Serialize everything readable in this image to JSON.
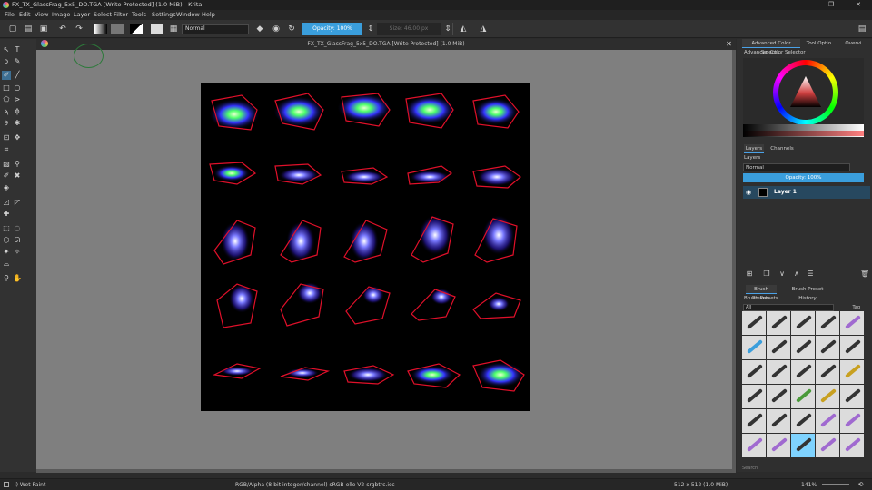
{
  "window": {
    "title": "FX_TX_GlassFrag_5x5_DO.TGA [Write Protected]  (1.0 MiB)  - Krita",
    "buttons": [
      "–",
      "❐",
      "✕"
    ]
  },
  "menu": [
    "File",
    "Edit",
    "View",
    "Image",
    "Layer",
    "Select",
    "Filter",
    "Tools",
    "Settings",
    "Window",
    "Help"
  ],
  "toolbar": {
    "blend_mode": "Normal",
    "opacity_label": "Opacity:  100%",
    "size_label": "Size:  46.00 px"
  },
  "document": {
    "tab_title": "FX_TX_GlassFrag_5x5_DO.TGA [Write Protected]  (1.0 MiB)"
  },
  "dock": {
    "top_tabs": [
      "Advanced Color Select...",
      "Tool Optio...",
      "Overvi..."
    ],
    "color_selector_title": "Advanced Color Selector",
    "layer_tabs": [
      "Layers",
      "Channels"
    ],
    "layers_title": "Layers",
    "layers_blend": "Normal",
    "layers_opacity": "Opacity:  100%",
    "layers": [
      {
        "name": "Layer 1"
      }
    ],
    "brush_tabs": [
      "Brush Presets",
      "Brush Preset History"
    ],
    "brush_presets_title": "Brush Presets",
    "brush_filter": "All",
    "brush_tag": "Tag",
    "search_placeholder": "Search"
  },
  "status": {
    "brush": "i) Wet Paint",
    "color_space": "RGB/Alpha (8-bit integer/channel)  sRGB-elle-V2-srgbtrc.icc",
    "dims": "512 x 512 (1.0 MiB)",
    "zoom": "141%"
  },
  "colors": {
    "accent": "#3a9edc",
    "selected_layer": "#27485f",
    "canvas_bg": "#7f7f7f"
  }
}
